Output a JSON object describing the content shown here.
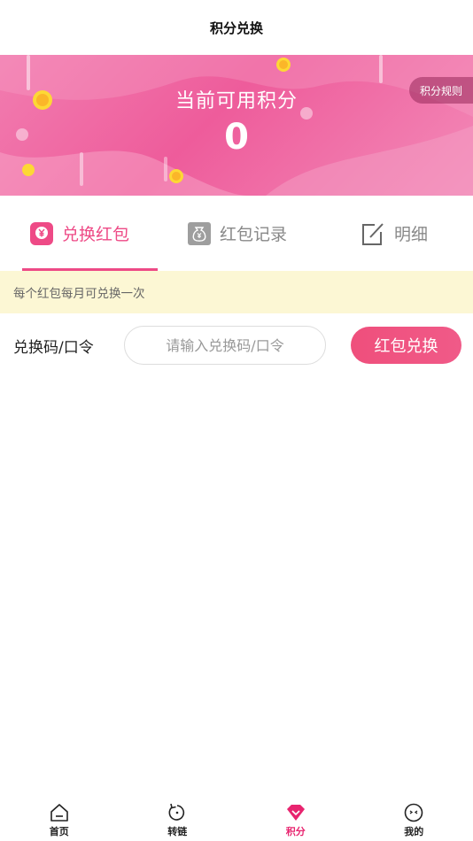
{
  "header": {
    "title": "积分兑换"
  },
  "banner": {
    "label": "当前可用积分",
    "points": "0",
    "rules_label": "积分规则"
  },
  "tabs": [
    {
      "label": "兑换红包",
      "icon": "red-envelope-icon",
      "active": true
    },
    {
      "label": "红包记录",
      "icon": "money-bag-icon",
      "active": false
    },
    {
      "label": "明细",
      "icon": "edit-icon",
      "active": false
    }
  ],
  "notice": {
    "text": "每个红包每月可兑换一次"
  },
  "redeem": {
    "code_label": "兑换码/口令",
    "input_placeholder": "请输入兑换码/口令",
    "input_value": "",
    "button_label": "红包兑换"
  },
  "bottom_nav": [
    {
      "label": "首页",
      "icon": "home-icon",
      "active": false
    },
    {
      "label": "转链",
      "icon": "refresh-icon",
      "active": false
    },
    {
      "label": "积分",
      "icon": "diamond-icon",
      "active": true
    },
    {
      "label": "我的",
      "icon": "face-icon",
      "active": false
    }
  ],
  "colors": {
    "accent": "#ee4a86",
    "banner_start": "#f27db0",
    "banner_mid": "#ee5c9b",
    "notice_bg": "#fcf7d4",
    "button": "#ef4f7c"
  }
}
